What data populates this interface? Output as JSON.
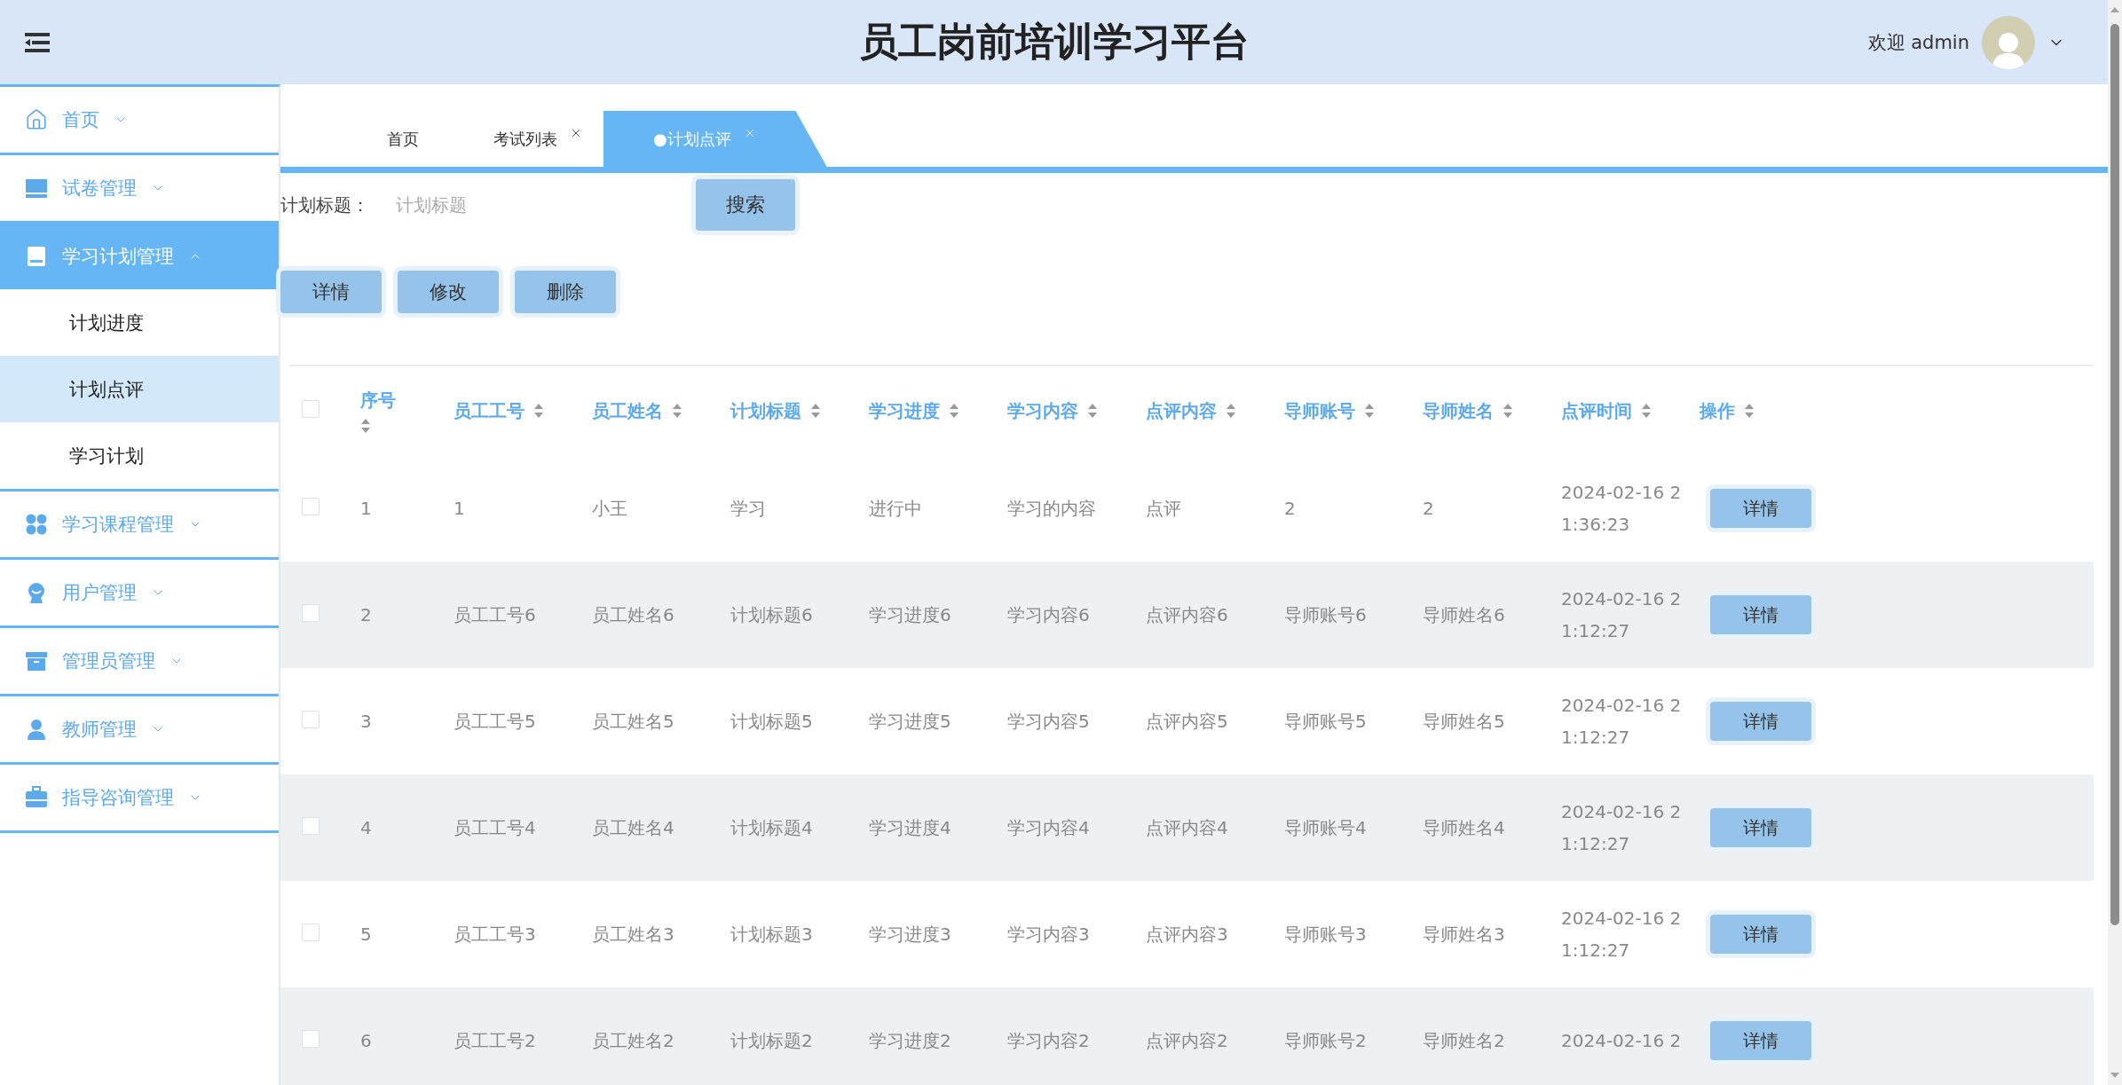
{
  "header": {
    "title": "员工岗前培训学习平台",
    "welcome": "欢迎 admin"
  },
  "sidebar": {
    "items": [
      {
        "kind": "home",
        "label": "首页",
        "expanded": false,
        "selected": false
      },
      {
        "kind": "paper",
        "label": "试卷管理",
        "expanded": false,
        "selected": false
      },
      {
        "kind": "plan",
        "label": "学习计划管理",
        "expanded": true,
        "selected": true,
        "children": [
          {
            "label": "计划进度",
            "selected": false
          },
          {
            "label": "计划点评",
            "selected": true
          },
          {
            "label": "学习计划",
            "selected": false
          }
        ]
      },
      {
        "kind": "course",
        "label": "学习课程管理",
        "expanded": false,
        "selected": false
      },
      {
        "kind": "user",
        "label": "用户管理",
        "expanded": false,
        "selected": false
      },
      {
        "kind": "admin",
        "label": "管理员管理",
        "expanded": false,
        "selected": false
      },
      {
        "kind": "teacher",
        "label": "教师管理",
        "expanded": false,
        "selected": false
      },
      {
        "kind": "consult",
        "label": "指导咨询管理",
        "expanded": false,
        "selected": false
      }
    ]
  },
  "tabs": [
    {
      "label": "首页",
      "closable": false,
      "selected": false
    },
    {
      "label": "考试列表",
      "closable": true,
      "selected": false
    },
    {
      "label": "●计划点评",
      "closable": true,
      "selected": true
    }
  ],
  "search": {
    "label": "计划标题：",
    "placeholder": "计划标题",
    "button": "搜索"
  },
  "actions": [
    "详情",
    "修改",
    "删除"
  ],
  "table": {
    "all_checked": false,
    "columns": [
      "序号",
      "员工工号",
      "员工姓名",
      "计划标题",
      "学习进度",
      "学习内容",
      "点评内容",
      "导师账号",
      "导师姓名",
      "点评时间",
      "操作"
    ],
    "rows": [
      {
        "checked": false,
        "cells": [
          "1",
          "1",
          "小王",
          "学习",
          "进行中",
          "学习的内容",
          "点评",
          "2",
          "2",
          "2024-02-16 21:36:23"
        ],
        "button": "详情"
      },
      {
        "checked": false,
        "cells": [
          "2",
          "员工工号6",
          "员工姓名6",
          "计划标题6",
          "学习进度6",
          "学习内容6",
          "点评内容6",
          "导师账号6",
          "导师姓名6",
          "2024-02-16 21:12:27"
        ],
        "button": "详情"
      },
      {
        "checked": false,
        "cells": [
          "3",
          "员工工号5",
          "员工姓名5",
          "计划标题5",
          "学习进度5",
          "学习内容5",
          "点评内容5",
          "导师账号5",
          "导师姓名5",
          "2024-02-16 21:12:27"
        ],
        "button": "详情"
      },
      {
        "checked": false,
        "cells": [
          "4",
          "员工工号4",
          "员工姓名4",
          "计划标题4",
          "学习进度4",
          "学习内容4",
          "点评内容4",
          "导师账号4",
          "导师姓名4",
          "2024-02-16 21:12:27"
        ],
        "button": "详情"
      },
      {
        "checked": false,
        "cells": [
          "5",
          "员工工号3",
          "员工姓名3",
          "计划标题3",
          "学习进度3",
          "学习内容3",
          "点评内容3",
          "导师账号3",
          "导师姓名3",
          "2024-02-16 21:12:27"
        ],
        "button": "详情"
      },
      {
        "checked": false,
        "cells": [
          "6",
          "员工工号2",
          "员工姓名2",
          "计划标题2",
          "学习进度2",
          "学习内容2",
          "点评内容2",
          "导师账号2",
          "导师姓名2",
          "2024-02-16 2"
        ],
        "button": "详情"
      }
    ]
  }
}
